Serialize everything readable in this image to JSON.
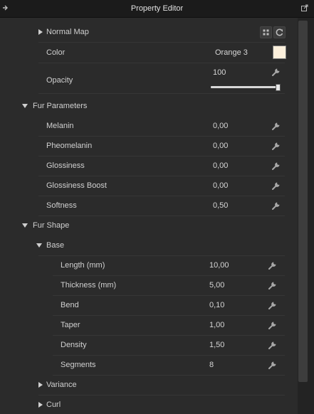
{
  "window": {
    "title": "Property Editor"
  },
  "icons": {
    "pin": "pin-icon",
    "popout": "popout-icon",
    "wrench": "wrench-icon",
    "grid": "grid-icon",
    "refresh": "refresh-icon",
    "expand": "triangle-right-icon",
    "collapse": "triangle-down-icon"
  },
  "colors": {
    "swatch": "#fcf0dc"
  },
  "normal_map": {
    "label": "Normal Map"
  },
  "color_row": {
    "label": "Color",
    "value": "Orange 3"
  },
  "opacity_row": {
    "label": "Opacity",
    "value": "100",
    "slider_fraction": 1.0
  },
  "fur_parameters": {
    "label": "Fur Parameters",
    "rows": [
      {
        "label": "Melanin",
        "value": "0,00"
      },
      {
        "label": "Pheomelanin",
        "value": "0,00"
      },
      {
        "label": "Glossiness",
        "value": "0,00"
      },
      {
        "label": "Glossiness Boost",
        "value": "0,00"
      },
      {
        "label": "Softness",
        "value": "0,50"
      }
    ]
  },
  "fur_shape": {
    "label": "Fur Shape",
    "base": {
      "label": "Base",
      "rows": [
        {
          "label": "Length (mm)",
          "value": "10,00"
        },
        {
          "label": "Thickness (mm)",
          "value": "5,00"
        },
        {
          "label": "Bend",
          "value": "0,10"
        },
        {
          "label": "Taper",
          "value": "1,00"
        },
        {
          "label": "Density",
          "value": "1,50"
        },
        {
          "label": "Segments",
          "value": "8"
        }
      ]
    },
    "variance": {
      "label": "Variance"
    },
    "curl": {
      "label": "Curl"
    }
  }
}
